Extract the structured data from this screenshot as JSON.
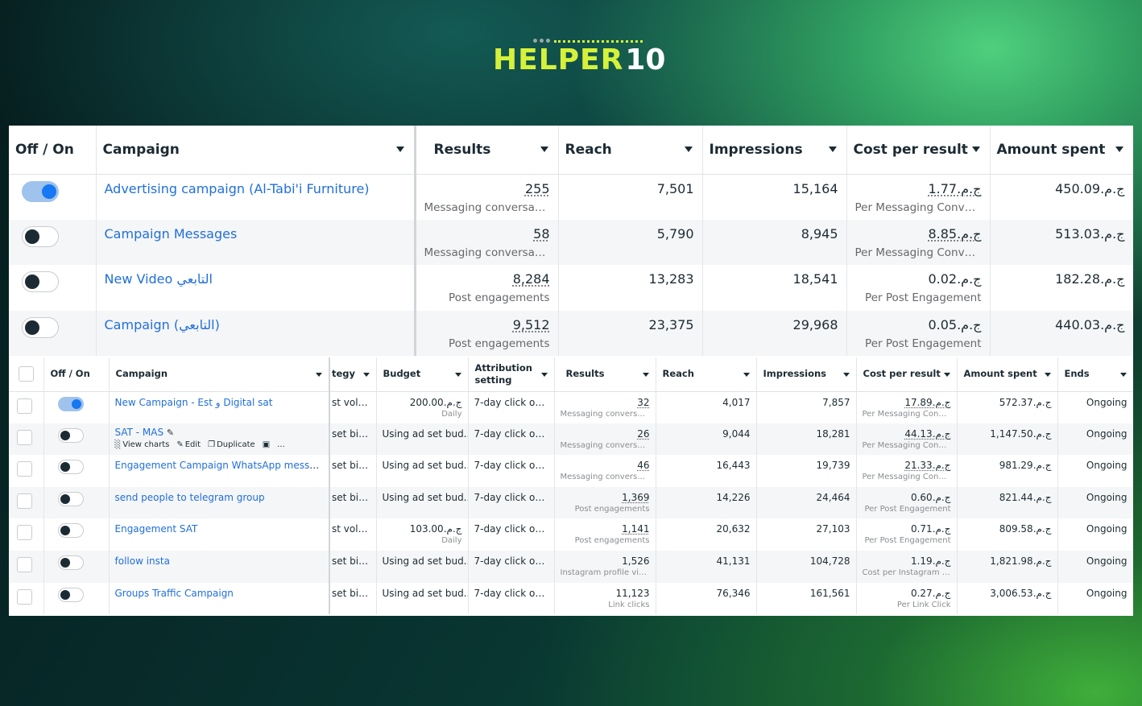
{
  "logo": {
    "word": "HELPER",
    "num": "10"
  },
  "top_table": {
    "headers": {
      "onoff": "Off / On",
      "campaign": "Campaign",
      "results": "Results",
      "reach": "Reach",
      "impressions": "Impressions",
      "cpr": "Cost per result",
      "spent": "Amount spent"
    },
    "rows": [
      {
        "on": true,
        "name": "Advertising campaign (Al-Tabi'i Furniture)",
        "results": "255",
        "results_sub": "Messaging conversati...",
        "reach": "7,501",
        "impressions": "15,164",
        "cpr": "ج.م.1.77",
        "cpr_sub": "Per Messaging Conve...",
        "spent": "ج.م.450.09"
      },
      {
        "on": false,
        "name": "Campaign Messages",
        "results": "58",
        "results_sub": "Messaging conversati...",
        "reach": "5,790",
        "impressions": "8,945",
        "cpr": "ج.م.8.85",
        "cpr_sub": "Per Messaging Conve...",
        "spent": "ج.م.513.03"
      },
      {
        "on": false,
        "name": "New Video التابعي",
        "results": "8,284",
        "results_sub": "Post engagements",
        "reach": "13,283",
        "impressions": "18,541",
        "cpr": "ج.م.0.02",
        "cpr_sub": "Per Post Engagement",
        "spent": "ج.م.182.28"
      },
      {
        "on": false,
        "name": "Campaign (التابعي)",
        "results": "9,512",
        "results_sub": "Post engagements",
        "reach": "23,375",
        "impressions": "29,968",
        "cpr": "ج.م.0.05",
        "cpr_sub": "Per Post Engagement",
        "spent": "ج.م.440.03"
      }
    ]
  },
  "bottom_table": {
    "headers": {
      "onoff": "Off / On",
      "campaign": "Campaign",
      "strategy": "tegy",
      "budget": "Budget",
      "attribution": "Attribution setting",
      "results": "Results",
      "reach": "Reach",
      "impressions": "Impressions",
      "cpr": "Cost per result",
      "spent": "Amount spent",
      "ends": "Ends"
    },
    "actions": {
      "view": "View charts",
      "edit": "Edit",
      "dup": "Duplicate",
      "more": "..."
    },
    "rows": [
      {
        "on": true,
        "name": "New Campaign - Est و Digital sat",
        "strategy": "st volume",
        "budget": "ج.م.200.00",
        "budget_sub": "Daily",
        "attribution": "7-day click or ...",
        "results": "32",
        "results_sub": "Messaging conversati...",
        "reach": "4,017",
        "impressions": "7,857",
        "cpr": "ج.م.17.89",
        "cpr_sub": "Per Messaging Conve...",
        "spent": "ج.م.572.37",
        "ends": "Ongoing"
      },
      {
        "on": false,
        "name": "SAT - MAS",
        "strategy": "set bid ...",
        "budget": "Using ad set bud...",
        "budget_sub": "",
        "attribution": "7-day click or ...",
        "results": "26",
        "results_sub": "Messaging conversati...",
        "reach": "9,044",
        "impressions": "18,281",
        "cpr": "ج.م.44.13",
        "cpr_sub": "Per Messaging Conve...",
        "spent": "ج.م.1,147.50",
        "ends": "Ongoing"
      },
      {
        "on": false,
        "name": "Engagement Campaign WhatsApp message eg...",
        "strategy": "set bid ...",
        "budget": "Using ad set bud...",
        "budget_sub": "",
        "attribution": "7-day click or ...",
        "results": "46",
        "results_sub": "Messaging conversati...",
        "reach": "16,443",
        "impressions": "19,739",
        "cpr": "ج.م.21.33",
        "cpr_sub": "Per Messaging Conve...",
        "spent": "ج.م.981.29",
        "ends": "Ongoing"
      },
      {
        "on": false,
        "name": "send people to telegram group",
        "strategy": "set bid ...",
        "budget": "Using ad set bud...",
        "budget_sub": "",
        "attribution": "7-day click or ...",
        "results": "1,369",
        "results_sub": "Post engagements",
        "reach": "14,226",
        "impressions": "24,464",
        "cpr": "ج.م.0.60",
        "cpr_sub": "Per Post Engagement",
        "spent": "ج.م.821.44",
        "ends": "Ongoing"
      },
      {
        "on": false,
        "name": "Engagement SAT",
        "strategy": "st volume",
        "budget": "ج.م.103.00",
        "budget_sub": "Daily",
        "attribution": "7-day click or ...",
        "results": "1,141",
        "results_sub": "Post engagements",
        "reach": "20,632",
        "impressions": "27,103",
        "cpr": "ج.م.0.71",
        "cpr_sub": "Per Post Engagement",
        "spent": "ج.م.809.58",
        "ends": "Ongoing"
      },
      {
        "on": false,
        "name": "follow insta",
        "strategy": "set bid ...",
        "budget": "Using ad set bud...",
        "budget_sub": "",
        "attribution": "7-day click or ...",
        "results": "1,526",
        "results_sub": "Instagram profile visits",
        "reach": "41,131",
        "impressions": "104,728",
        "cpr": "ج.م.1.19",
        "cpr_sub": "Cost per Instagram pr...",
        "spent": "ج.م.1,821.98",
        "ends": "Ongoing"
      },
      {
        "on": false,
        "name": "Groups Traffic Campaign",
        "strategy": "set bid ...",
        "budget": "Using ad set bud...",
        "budget_sub": "",
        "attribution": "7-day click or ...",
        "results": "11,123",
        "results_sub": "Link clicks",
        "reach": "76,346",
        "impressions": "161,561",
        "cpr": "ج.م.0.27",
        "cpr_sub": "Per Link Click",
        "spent": "ج.م.3,006.53",
        "ends": "Ongoing"
      }
    ]
  }
}
